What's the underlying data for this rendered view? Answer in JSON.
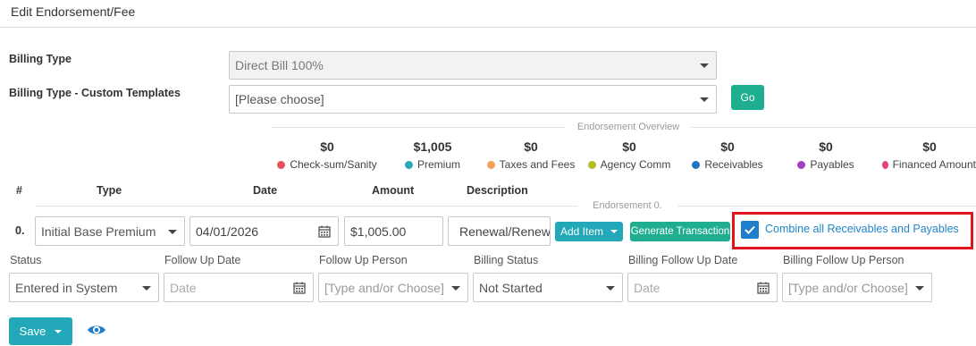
{
  "panel": {
    "title": "Edit Endorsement/Fee"
  },
  "billing": {
    "type_label": "Billing Type",
    "type_value": "Direct Bill 100%",
    "custom_label": "Billing Type - Custom Templates",
    "custom_value": "[Please choose]",
    "go_label": "Go"
  },
  "overview": {
    "caption": "Endorsement Overview",
    "stats": [
      {
        "value": "$0",
        "label": "Check-sum/Sanity",
        "color": "#e8505b"
      },
      {
        "value": "$1,005",
        "label": "Premium",
        "color": "#2aa8b8"
      },
      {
        "value": "$0",
        "label": "Taxes and Fees",
        "color": "#f4a05a"
      },
      {
        "value": "$0",
        "label": "Agency Comm",
        "color": "#b5bd22"
      },
      {
        "value": "$0",
        "label": "Receivables",
        "color": "#2075c0"
      },
      {
        "value": "$0",
        "label": "Payables",
        "color": "#a23fc4"
      },
      {
        "value": "$0",
        "label": "Financed Amount",
        "color": "#e8407e"
      }
    ]
  },
  "columns": {
    "num": "#",
    "type": "Type",
    "date": "Date",
    "amount": "Amount",
    "description": "Description"
  },
  "endorsement": {
    "caption": "Endorsement 0.",
    "row_num": "0.",
    "type": "Initial Base Premium",
    "date": "04/01/2026",
    "amount": "$1,005.00",
    "description": "Renewal/Renewal",
    "add_item_label": "Add Item",
    "generate_label": "Generate Transaction",
    "combine_label": "Combine all Receivables and Payables",
    "combine_checked": true
  },
  "followup": {
    "status_label": "Status",
    "status_value": "Entered in System",
    "follow_date_label": "Follow Up Date",
    "follow_date_placeholder": "Date",
    "follow_person_label": "Follow Up Person",
    "follow_person_placeholder": "[Type and/or Choose]",
    "billing_status_label": "Billing Status",
    "billing_status_value": "Not Started",
    "billing_follow_date_label": "Billing Follow Up Date",
    "billing_follow_date_placeholder": "Date",
    "billing_follow_person_label": "Billing Follow Up Person",
    "billing_follow_person_placeholder": "[Type and/or Choose]"
  },
  "footer": {
    "save_label": "Save"
  },
  "colors": {
    "green": "#1fae8f",
    "teal": "#22a8b8",
    "checkbox": "#1f7ecb",
    "highlight": "#e0141e"
  },
  "icons": {
    "calendar": "calendar-icon",
    "eye": "eye-icon",
    "check": "check-icon"
  }
}
